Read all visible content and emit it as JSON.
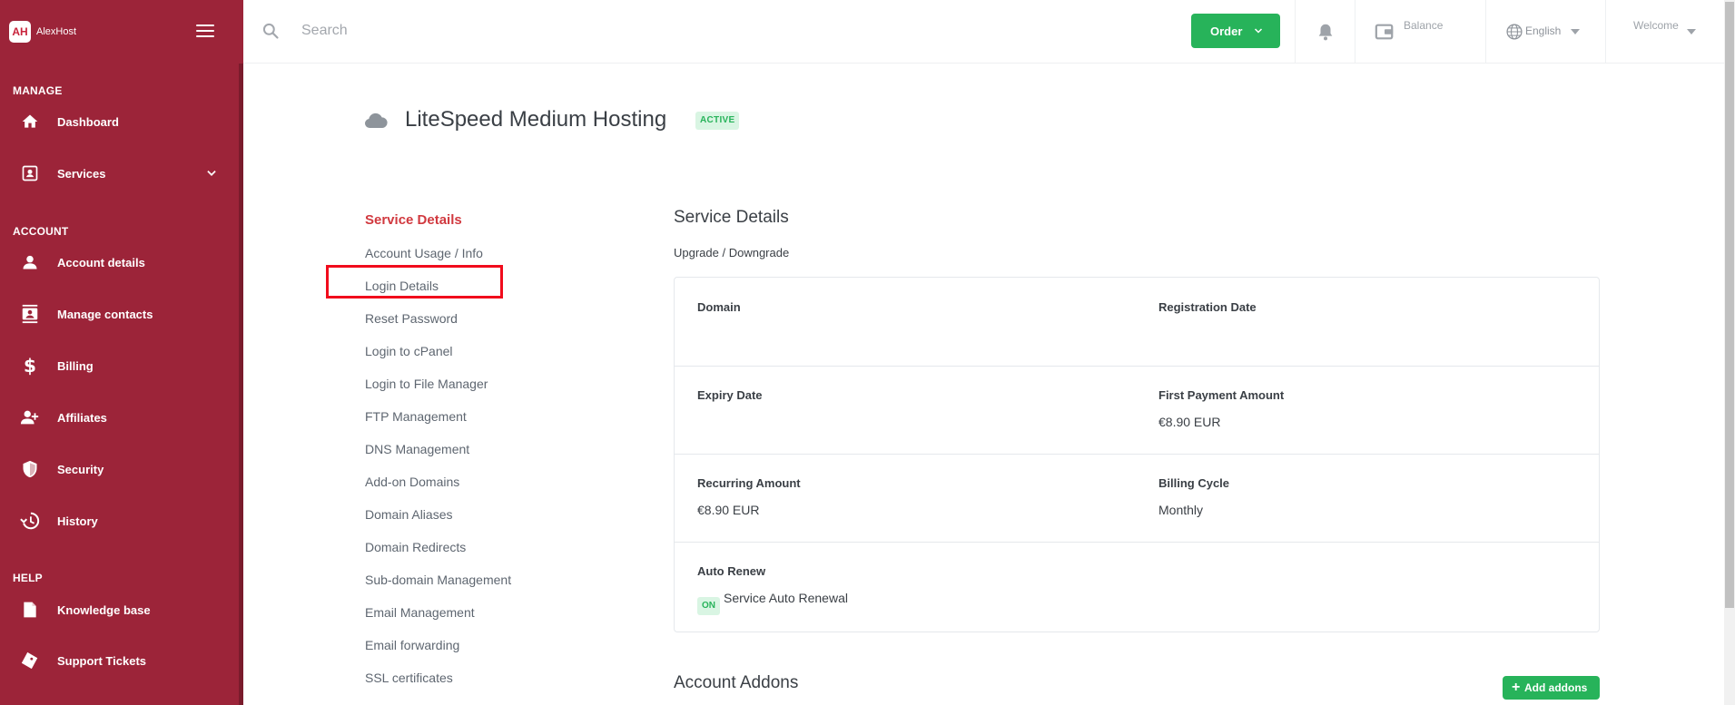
{
  "brand": {
    "logo_text": "AH",
    "name": "AlexHost"
  },
  "sidebar": {
    "sections": [
      {
        "label": "MANAGE"
      },
      {
        "label": "ACCOUNT"
      },
      {
        "label": "HELP"
      }
    ],
    "items": [
      {
        "label": "Dashboard",
        "icon": "home-icon"
      },
      {
        "label": "Services",
        "icon": "services-icon"
      },
      {
        "label": "Account details",
        "icon": "user-icon"
      },
      {
        "label": "Manage contacts",
        "icon": "contacts-icon"
      },
      {
        "label": "Billing",
        "icon": "dollar-icon"
      },
      {
        "label": "Affiliates",
        "icon": "affiliates-icon"
      },
      {
        "label": "Security",
        "icon": "shield-icon"
      },
      {
        "label": "History",
        "icon": "history-icon"
      },
      {
        "label": "Knowledge base",
        "icon": "book-icon"
      },
      {
        "label": "Support Tickets",
        "icon": "ticket-icon"
      }
    ]
  },
  "header": {
    "search_placeholder": "Search",
    "order_label": "Order",
    "balance_label": "Balance",
    "language": "English",
    "welcome": "Welcome"
  },
  "page": {
    "title": "LiteSpeed Medium Hosting",
    "status": "ACTIVE"
  },
  "submenu": {
    "items": [
      "Service Details",
      "Account Usage / Info",
      "Login Details",
      "Reset Password",
      "Login to cPanel",
      "Login to File Manager",
      "FTP Management",
      "DNS Management",
      "Add-on Domains",
      "Domain Aliases",
      "Domain Redirects",
      "Sub-domain Management",
      "Email Management",
      "Email forwarding",
      "SSL certificates"
    ],
    "active_index": 0,
    "highlighted_index": 2
  },
  "details": {
    "title": "Service Details",
    "upgrade_link": "Upgrade / Downgrade",
    "domain_label": "Domain",
    "registration_label": "Registration Date",
    "expiry_label": "Expiry Date",
    "first_payment_label": "First Payment Amount",
    "first_payment_value": "€8.90 EUR",
    "recurring_label": "Recurring Amount",
    "recurring_value": "€8.90 EUR",
    "billing_cycle_label": "Billing Cycle",
    "billing_cycle_value": "Monthly",
    "auto_renew_label": "Auto Renew",
    "auto_renew_badge": "ON",
    "auto_renew_value": "Service Auto Renewal"
  },
  "addons": {
    "title": "Account Addons",
    "add_button": "Add addons"
  },
  "colors": {
    "sidebar_bg": "#9c2439",
    "accent_green": "#27b35a",
    "active_red": "#d1393f",
    "highlight_border": "#f10c1c"
  }
}
